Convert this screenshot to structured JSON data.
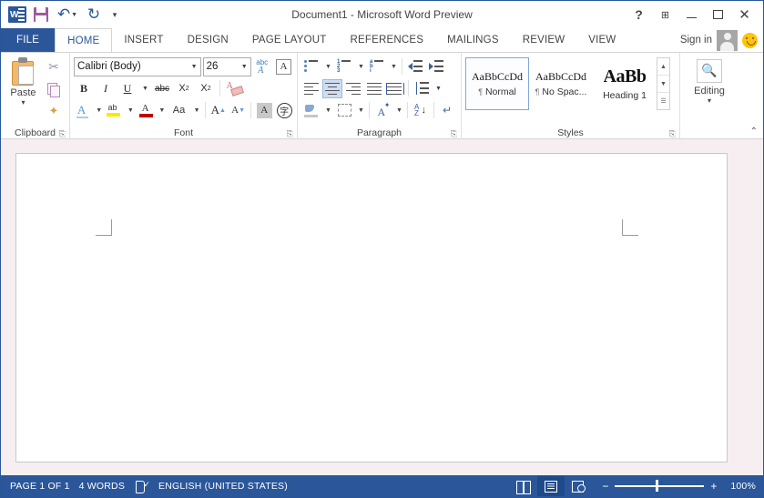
{
  "window": {
    "title": "Document1 - Microsoft Word Preview",
    "quick_access": [
      {
        "name": "word-logo-icon",
        "label": "W"
      },
      {
        "name": "save-icon",
        "label": "Save"
      },
      {
        "name": "undo-icon",
        "label": "Undo"
      },
      {
        "name": "redo-icon",
        "label": "Redo"
      },
      {
        "name": "customize-qat-icon",
        "label": "Customize Quick Access Toolbar"
      }
    ],
    "controls": {
      "help": "?",
      "ribbon_display": "Ribbon Display Options",
      "minimize": "Minimize",
      "maximize": "Maximize",
      "close": "✕"
    }
  },
  "tabs": {
    "file": "FILE",
    "items": [
      {
        "label": "HOME",
        "active": true
      },
      {
        "label": "INSERT",
        "active": false
      },
      {
        "label": "DESIGN",
        "active": false
      },
      {
        "label": "PAGE LAYOUT",
        "active": false
      },
      {
        "label": "REFERENCES",
        "active": false
      },
      {
        "label": "MAILINGS",
        "active": false
      },
      {
        "label": "REVIEW",
        "active": false
      },
      {
        "label": "VIEW",
        "active": false
      }
    ],
    "sign_in": "Sign in"
  },
  "ribbon": {
    "clipboard": {
      "label": "Clipboard",
      "paste": "Paste",
      "cut": "Cut",
      "copy": "Copy",
      "format_painter": "Format Painter",
      "launcher": "⎘"
    },
    "font": {
      "label": "Font",
      "font_name": "Calibri (Body)",
      "font_size": "26",
      "bold": "B",
      "italic": "I",
      "underline": "U",
      "strikethrough": "abc",
      "subscript": "X₂",
      "superscript": "X²",
      "grow_font": "A",
      "shrink_font": "A",
      "change_case": "Aa",
      "clear_formatting": "Clear All Formatting",
      "text_effects": "A",
      "text_highlight": "Text Highlight Color",
      "font_color": "A",
      "phonetic_guide": "Phonetic Guide",
      "character_border": "A",
      "character_shading": "A",
      "launcher": "⎘"
    },
    "paragraph": {
      "label": "Paragraph",
      "bullets": "Bullets",
      "numbering": "Numbering",
      "multilevel_list": "Multilevel List",
      "decrease_indent": "Decrease Indent",
      "increase_indent": "Increase Indent",
      "align_left": "Align Left",
      "align_center": "Center",
      "align_right": "Align Right",
      "justify": "Justify",
      "distributed": "Distributed",
      "line_spacing": "Line and Paragraph Spacing",
      "shading": "Shading",
      "borders": "Borders",
      "asian_layout": "Asian Layout",
      "sort": "Sort",
      "show_marks": "Show/Hide ¶",
      "active_alignment": "align_center",
      "launcher": "⎘"
    },
    "styles": {
      "label": "Styles",
      "items": [
        {
          "preview": "AaBbCcDd",
          "name": "Normal",
          "pilcrow": "¶",
          "selected": true,
          "heading": false
        },
        {
          "preview": "AaBbCcDd",
          "name": "No Spac...",
          "pilcrow": "¶",
          "selected": false,
          "heading": false
        },
        {
          "preview": "AaBb",
          "name": "Heading 1",
          "pilcrow": "",
          "selected": false,
          "heading": true
        }
      ],
      "scroll_up": "▲",
      "scroll_down": "▼",
      "more": "☰",
      "launcher": "⎘"
    },
    "editing": {
      "label": "Editing",
      "icon": "binoculars-icon",
      "caret": "▾"
    },
    "collapse": "⌃"
  },
  "document": {
    "ghost_line_1": "",
    "ghost_line_2": ""
  },
  "status_bar": {
    "page": "PAGE 1 OF 1",
    "words": "4 WORDS",
    "proofing": "Proofing errors",
    "language": "ENGLISH (UNITED STATES)",
    "views": [
      {
        "name": "read-mode-view-button",
        "selected": false
      },
      {
        "name": "print-layout-view-button",
        "selected": true
      },
      {
        "name": "web-layout-view-button",
        "selected": false
      }
    ],
    "zoom_out": "−",
    "zoom_in": "+",
    "zoom_level": "100%"
  },
  "colors": {
    "accent_blue": "#2b579a",
    "doc_background": "#f6eef0",
    "page_white": "#ffffff",
    "highlight_select": "#cfddf2"
  }
}
